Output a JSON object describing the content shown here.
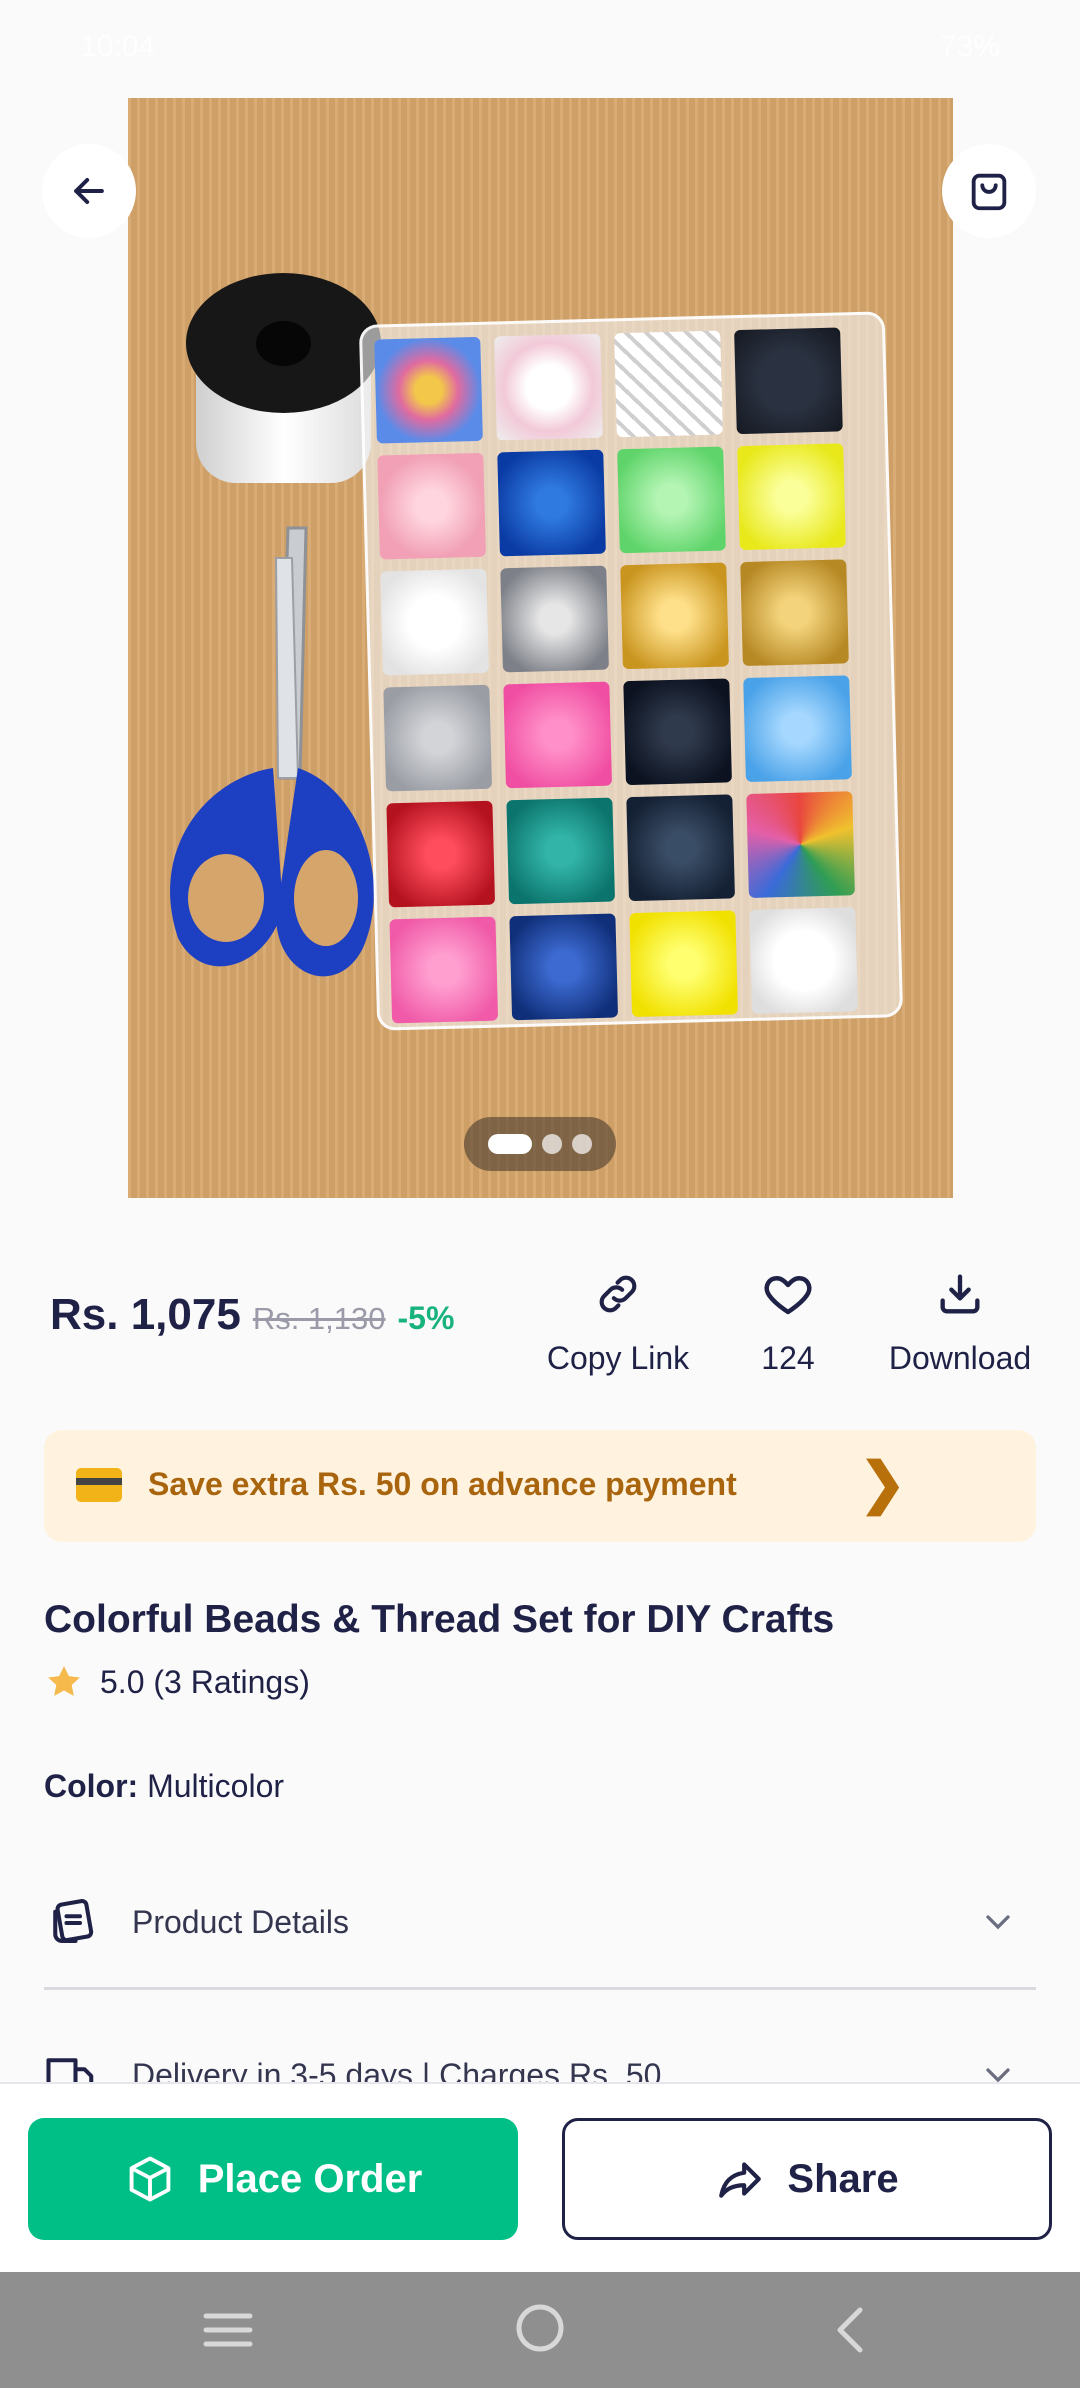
{
  "status_bar": {
    "time": "10:04",
    "battery": "73%"
  },
  "header": {
    "back_icon": "arrow-left-icon",
    "cart_icon": "shopping-bag-icon"
  },
  "image_carousel": {
    "total": 3,
    "active": 1
  },
  "pricing": {
    "price": "Rs. 1,075",
    "mrp": "Rs. 1,130",
    "discount": "-5%"
  },
  "actions": {
    "copy_link": "Copy Link",
    "likes": "124",
    "download": "Download"
  },
  "promo": {
    "text": "Save extra Rs. 50 on advance payment",
    "accent": "#a9650e",
    "background": "#fff2de"
  },
  "product": {
    "title": "Colorful Beads & Thread Set for DIY Crafts",
    "rating": "5.0 (3 Ratings)",
    "color_label": "Color:",
    "color_value": "Multicolor"
  },
  "accordion": {
    "details_label": "Product Details",
    "delivery_label": "Delivery in 3-5 days | Charges Rs. 50"
  },
  "footer": {
    "place_order": "Place Order",
    "share": "Share",
    "primary_color": "#00bf86"
  }
}
